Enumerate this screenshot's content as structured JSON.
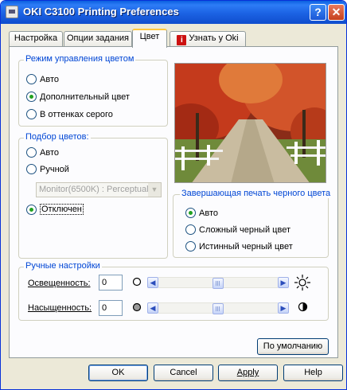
{
  "window": {
    "title": "OKI C3100 Printing Preferences",
    "help_glyph": "?",
    "close_glyph": "✕"
  },
  "tabs": [
    {
      "label": "Настройка"
    },
    {
      "label": "Опции задания"
    },
    {
      "label": "Цвет",
      "active": true
    },
    {
      "label": "Узнать у Oki",
      "icon": "info-icon"
    }
  ],
  "color_mode": {
    "legend": "Режим управления цветом",
    "options": [
      {
        "label": "Авто",
        "selected": false
      },
      {
        "label": "Дополнительный цвет",
        "selected": true
      },
      {
        "label": "В оттенках серого",
        "selected": false
      }
    ]
  },
  "color_matching": {
    "legend": "Подбор цветов:",
    "options": [
      {
        "label": "Авто",
        "selected": false
      },
      {
        "label": "Ручной",
        "selected": false
      },
      {
        "label": "Отключен",
        "selected": true
      }
    ],
    "profile_select": {
      "value": "Monitor(6500K) : Perceptual",
      "disabled": true
    }
  },
  "preview_image": {
    "description_icon": "autumn-road-photo"
  },
  "black_finish": {
    "legend": "Завершающая печать черного цвета",
    "options": [
      {
        "label": "Авто",
        "selected": true
      },
      {
        "label": "Сложный черный цвет",
        "selected": false
      },
      {
        "label": "Истинный черный цвет",
        "selected": false
      }
    ]
  },
  "manual": {
    "legend": "Ручные настройки",
    "brightness": {
      "label": "Освещенность:",
      "value": "0",
      "level": 0.5,
      "min_icon": "circle-outline-icon",
      "max_icon": "sun-icon"
    },
    "saturation": {
      "label": "Насыщенность:",
      "value": "0",
      "level": 0.5,
      "min_icon": "gray-circle-icon",
      "max_icon": "half-circle-icon"
    }
  },
  "defaults_button": "По умолчанию",
  "footer": {
    "ok": "OK",
    "cancel": "Cancel",
    "apply": "Apply",
    "help": "Help"
  },
  "colors": {
    "titlebar": "#1b62e3",
    "group_label": "#0046d5",
    "tab_highlight": "#ffc73c",
    "radio_dot": "#21a121"
  }
}
